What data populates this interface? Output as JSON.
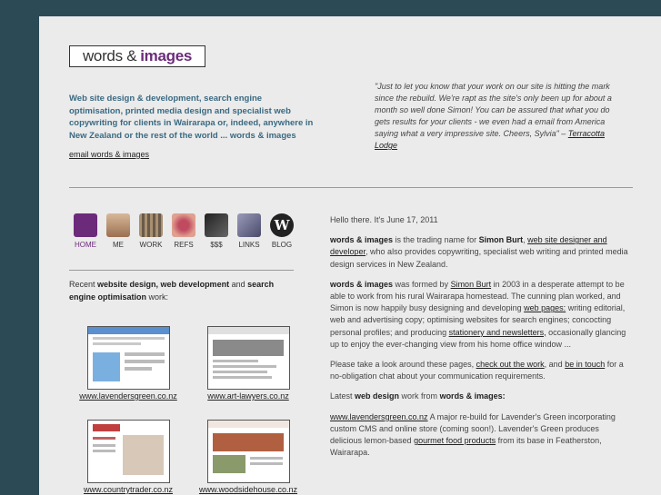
{
  "logo": {
    "words": "words &",
    "images": "images"
  },
  "tagline": "Web site design & development, search engine optimisation, printed media design and specialist web copywriting for clients in Wairarapa or, indeed, anywhere in New Zealand or the rest of the world ... words & images",
  "email_link": "email words & images",
  "quote": {
    "text": "\"Just to let you know that your work on our site is hitting the mark since the rebuild. We're rapt as the site's only been up for about a month so well done Simon! You can be assured that what you do gets results for your clients - we even had a email from America saying what a very impressive site. Cheers, Sylvia\" – ",
    "link": "Terracotta Lodge"
  },
  "nav": [
    {
      "label": "HOME",
      "icon": "home-logo-icon",
      "color": "#6b2b7a"
    },
    {
      "label": "ME",
      "icon": "portrait-icon",
      "color": "#b89070"
    },
    {
      "label": "WORK",
      "icon": "work-icon",
      "color": "#8c7a6a"
    },
    {
      "label": "REFS",
      "icon": "lips-icon",
      "color": "#c06070"
    },
    {
      "label": "$$$",
      "icon": "money-icon",
      "color": "#3a3a3a"
    },
    {
      "label": "LINKS",
      "icon": "links-icon",
      "color": "#6a6a8a"
    },
    {
      "label": "BLOG",
      "icon": "wordpress-icon",
      "color": "#222"
    }
  ],
  "recent": {
    "pre": "Recent ",
    "b1": "website design, web development",
    "mid": " and ",
    "b2": "search engine optimisation",
    "post": " work:"
  },
  "portfolio": [
    {
      "caption": "www.lavendersgreen.co.nz",
      "accent": "#5a8fd0"
    },
    {
      "caption": "www.art-lawyers.co.nz",
      "accent": "#7a7a7a"
    },
    {
      "caption": "www.countrytrader.co.nz",
      "accent": "#c04040"
    },
    {
      "caption": "www.woodsidehouse.co.nz",
      "accent": "#b04020"
    }
  ],
  "main": {
    "greeting": "Hello there. It's June 17, 2011",
    "p1": {
      "b1": "words & images",
      "t1": " is the trading name for ",
      "b2": "Simon Burt",
      "t2": ", ",
      "link": "web site designer and developer",
      "t3": ", who also provides copywriting, specialist web writing and printed media design services in New Zealand."
    },
    "p2": {
      "b1": "words & images",
      "t1": " was formed by ",
      "link1": "Simon Burt",
      "t2": " in 2003 in a desperate attempt to be able to work from his rural Wairarapa homestead. The cunning plan worked, and Simon is now happily busy designing and developing ",
      "link2": "web pages:",
      "t3": " writing editorial, web and advertising copy; optimising websites for search engines; concocting personal profiles; and producing ",
      "link3": "stationery and newsletters,",
      "t4": " occasionally glancing up to enjoy the ever-changing view from his home office window ..."
    },
    "p3": {
      "t1": "Please take a look around these pages, ",
      "link1": "check out the work",
      "t2": ", and ",
      "link2": "be in touch",
      "t3": " for a no-obligation chat about your communication requirements."
    },
    "p4": {
      "t1": "Latest ",
      "b1": "web design",
      "t2": " work from ",
      "b2": "words & images:"
    },
    "p5": {
      "link1": "www.lavendersgreen.co.nz",
      "t1": " A major re-build for Lavender's Green incorporating custom CMS and online store (coming soon!). Lavender's Green produces delicious lemon-based ",
      "link2": "gourmet food products",
      "t2": " from its base in Featherston, Wairarapa."
    }
  }
}
